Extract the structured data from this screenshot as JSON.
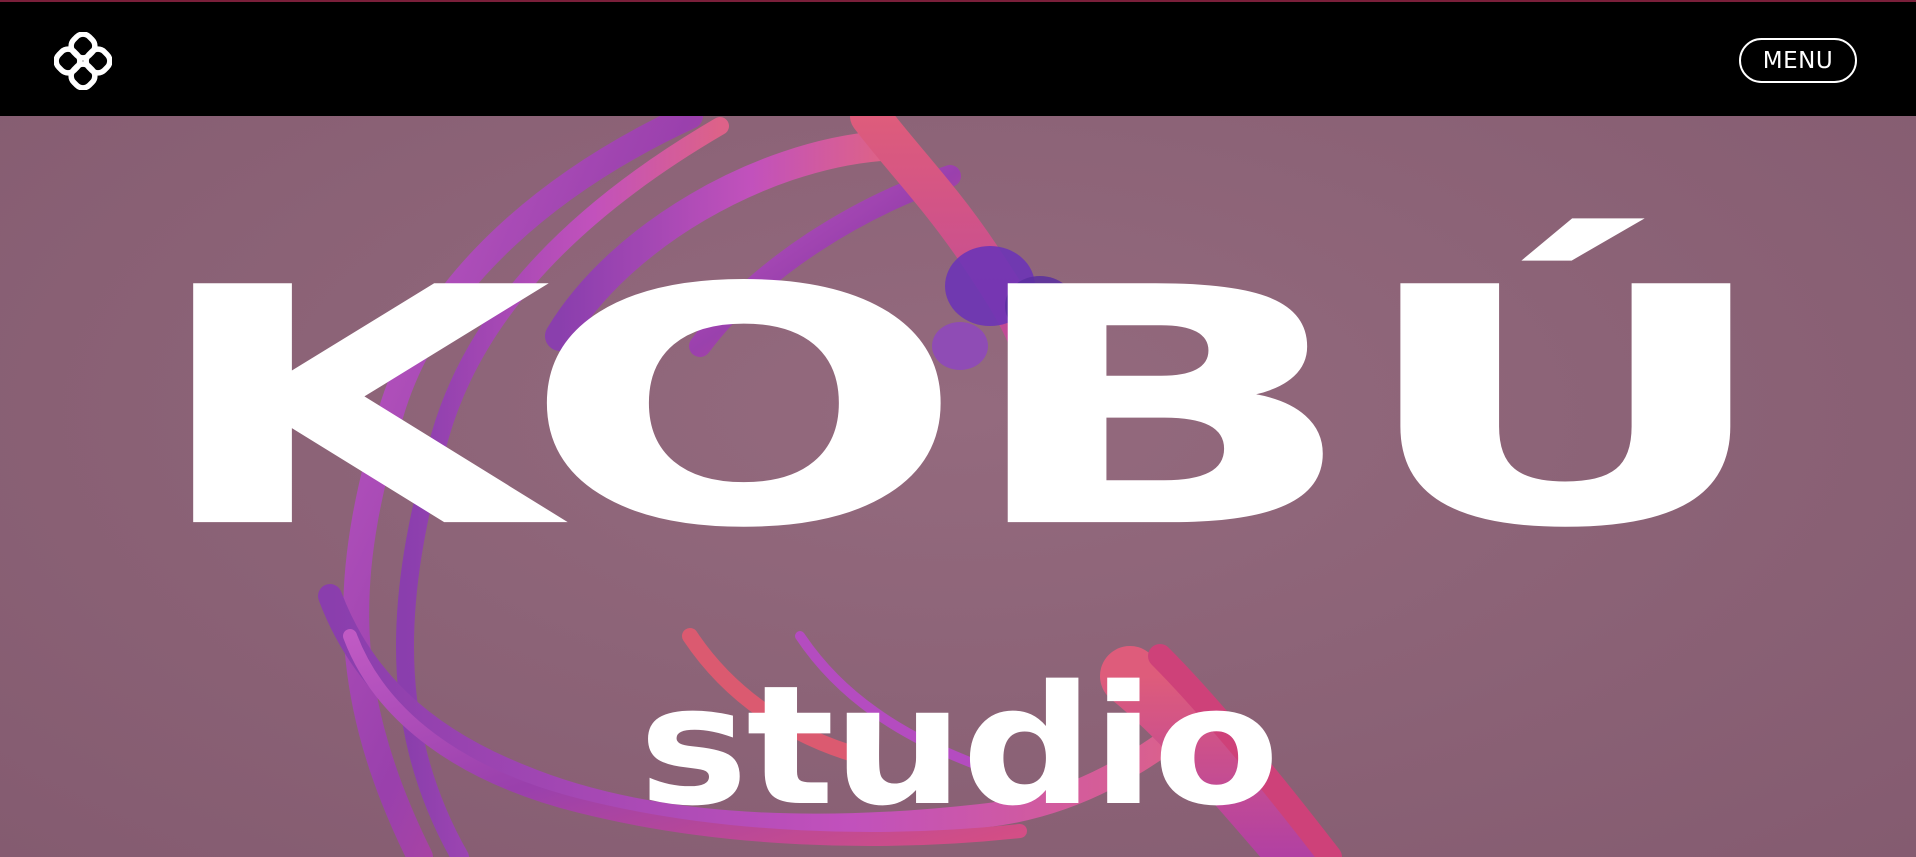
{
  "header": {
    "logo_icon": "kobu-clover-logo-icon",
    "menu_label": "MENU"
  },
  "hero": {
    "brand_title": "KOBÚ",
    "subtitle": "studio",
    "background_color": "#8c6477",
    "art_colors": [
      "#b44fbf",
      "#7d3aa8",
      "#e04d7a",
      "#5a2fa0"
    ]
  }
}
